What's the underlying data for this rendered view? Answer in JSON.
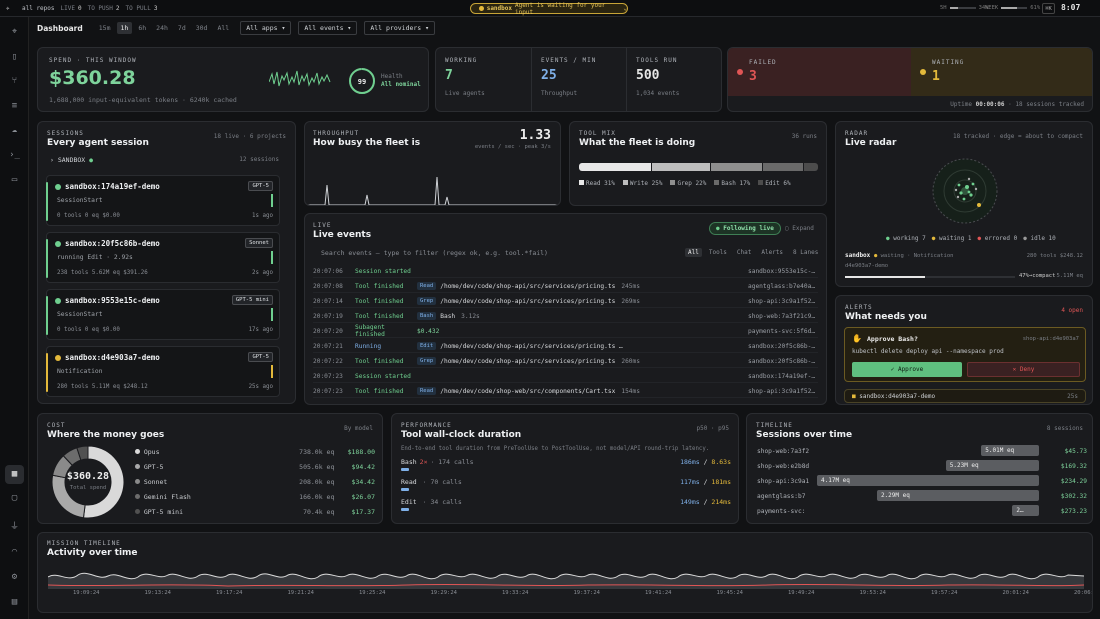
{
  "topbar": {
    "logo": "rocket-icon",
    "repos": "all repos",
    "live": "LIVE",
    "live_n": "0",
    "push": "TO PUSH",
    "push_n": "2",
    "pull": "TO PULL",
    "pull_n": "3",
    "waiting_tag": "sandbox",
    "waiting_text": "Agent is waiting for your input",
    "m1_label": "5H",
    "m1_val": "34%",
    "m1_fill": 0.34,
    "m2_label": "WEEK",
    "m2_val": "61%",
    "m2_fill": 0.61,
    "kbd": "⌘K",
    "clock": "8:07"
  },
  "filters": {
    "title": "Dashboard",
    "ranges": [
      "15m",
      "1h",
      "6h",
      "24h",
      "7d",
      "30d",
      "All"
    ],
    "active": "1h",
    "apps": "All apps",
    "events": "All events",
    "providers": "All providers"
  },
  "spend": {
    "label": "SPEND · THIS WINDOW",
    "value": "$360.28",
    "sub": "1,688,000 input-equivalent tokens · 6240k cached",
    "health_n": "99",
    "health_label": "Health",
    "health_status": "All nominal",
    "health_frac": 0.99
  },
  "kpis": [
    {
      "label": "WORKING",
      "value": "7",
      "sub": "Live agents",
      "color": "#7ed39b"
    },
    {
      "label": "EVENTS / MIN",
      "value": "25",
      "sub": "Throughput",
      "color": "#7fb0e8"
    },
    {
      "label": "TOOLS RUN",
      "value": "500",
      "sub": "1,034 events",
      "color": "#e6e6e6"
    }
  ],
  "failed": {
    "label": "FAILED",
    "value": "3"
  },
  "waiting": {
    "label": "WAITING",
    "value": "1"
  },
  "uptime": {
    "label": "Uptime",
    "value": "00:00:06",
    "tracked": "18 sessions tracked"
  },
  "sessions": {
    "label": "SESSIONS",
    "title": "Every agent session",
    "meta": "18 live · 6 projects",
    "group": "SANDBOX",
    "group_count": "12 sessions",
    "items": [
      {
        "name": "sandbox:174a19ef-demo",
        "model": "GPT-5",
        "status": "SessionStart",
        "stats": "0 tools  0 eq  $0.00",
        "age": "1s ago",
        "color": "#6fcf8f"
      },
      {
        "name": "sandbox:20f5c86b-demo",
        "model": "Sonnet",
        "status": "running Edit · 2.92s",
        "stats": "238 tools  5.62M eq  $391.26",
        "age": "2s ago",
        "color": "#6fcf8f"
      },
      {
        "name": "sandbox:9553e15c-demo",
        "model": "GPT-5 mini",
        "status": "SessionStart",
        "stats": "0 tools  0 eq  $0.00",
        "age": "17s ago",
        "color": "#6fcf8f"
      },
      {
        "name": "sandbox:d4e903a7-demo",
        "model": "GPT-5",
        "status": "Notification",
        "stats": "280 tools  5.11M eq  $248.12",
        "age": "25s ago",
        "color": "#e3b93b"
      }
    ]
  },
  "throughput": {
    "label": "THROUGHPUT",
    "title": "How busy the fleet is",
    "value": "1.33",
    "unit": "events / sec · peak 3/s"
  },
  "toolmix": {
    "label": "TOOL MIX",
    "title": "What the fleet is doing",
    "runs": "36 runs",
    "items": [
      {
        "name": "Read",
        "pct": "31%",
        "frac": 0.31,
        "color": "#e8e8e8"
      },
      {
        "name": "Write",
        "pct": "25%",
        "frac": 0.25,
        "color": "#bdbdbd"
      },
      {
        "name": "Grep",
        "pct": "22%",
        "frac": 0.22,
        "color": "#8f8f8f"
      },
      {
        "name": "Bash",
        "pct": "17%",
        "frac": 0.17,
        "color": "#6a6a6a"
      },
      {
        "name": "Edit",
        "pct": "6%",
        "frac": 0.06,
        "color": "#4c4c4c"
      }
    ]
  },
  "radar": {
    "label": "RADAR",
    "title": "Live radar",
    "meta": "18 tracked · edge = about to compact",
    "legend": [
      {
        "t": "working 7",
        "c": "#6fcf8f"
      },
      {
        "t": "waiting 1",
        "c": "#e3b93b"
      },
      {
        "t": "errored 0",
        "c": "#e05555"
      },
      {
        "t": "idle 10",
        "c": "#999"
      }
    ],
    "session": "sandbox",
    "state": "waiting · Notification",
    "id": "d4e903a7-demo",
    "stats": "280 tools  $248.12",
    "compact": "47%→compact",
    "eq": "5.11M eq",
    "compact_frac": 0.47
  },
  "live": {
    "label": "LIVE",
    "title": "Live events",
    "following": "Following live",
    "expand": "Expand",
    "filter_ph": "Search events — type to filter (regex ok, e.g. tool.*fail)",
    "tabs": [
      "All",
      "Tools",
      "Chat",
      "Alerts",
      "8 Lanes"
    ],
    "events": [
      {
        "t": "20:07:06",
        "k": "Session started",
        "tool": "",
        "d": "",
        "ms": "",
        "s": "sandbox:9553e15c-…",
        "c": "#6fcf8f"
      },
      {
        "t": "20:07:08",
        "k": "Tool finished",
        "tool": "Read",
        "d": "/home/dev/code/shop-api/src/services/pricing.ts",
        "ms": "245ms",
        "s": "agentglass:b7e40a…",
        "c": "#6fcf8f"
      },
      {
        "t": "20:07:14",
        "k": "Tool finished",
        "tool": "Grep",
        "d": "/home/dev/code/shop-api/src/services/pricing.ts",
        "ms": "269ms",
        "s": "shop-api:3c9a1f52…",
        "c": "#6fcf8f"
      },
      {
        "t": "20:07:19",
        "k": "Tool finished",
        "tool": "Bash",
        "d": "Bash",
        "ms": "3.12s",
        "s": "shop-web:7a3f21c9…",
        "c": "#6fcf8f"
      },
      {
        "t": "20:07:20",
        "k": "Subagent finished",
        "tool": "",
        "d": "$0.432",
        "ms": "",
        "s": "payments-svc:5f6d…",
        "c": "#6fcf8f"
      },
      {
        "t": "20:07:21",
        "k": "Running",
        "tool": "Edit",
        "d": "/home/dev/code/shop-api/src/services/pricing.ts …",
        "ms": "",
        "s": "sandbox:20f5c86b-…",
        "c": "#7fb0e8"
      },
      {
        "t": "20:07:22",
        "k": "Tool finished",
        "tool": "Grep",
        "d": "/home/dev/code/shop-api/src/services/pricing.ts",
        "ms": "260ms",
        "s": "sandbox:20f5c86b-…",
        "c": "#6fcf8f"
      },
      {
        "t": "20:07:23",
        "k": "Session started",
        "tool": "",
        "d": "",
        "ms": "",
        "s": "sandbox:174a19ef-…",
        "c": "#6fcf8f"
      },
      {
        "t": "20:07:23",
        "k": "Tool finished",
        "tool": "Read",
        "d": "/home/dev/code/shop-web/src/components/Cart.tsx",
        "ms": "154ms",
        "s": "shop-api:3c9a1f52…",
        "c": "#6fcf8f"
      }
    ]
  },
  "alerts": {
    "label": "ALERTS",
    "title": "What needs you",
    "count": "4 open",
    "approve_title": "Approve Bash?",
    "approve_src": "shop-api:d4e903a7",
    "cmd": "kubectl delete deploy api --namespace prod",
    "approve": "✓ Approve",
    "deny": "✕ Deny",
    "next": "sandbox:d4e903a7-demo",
    "next_age": "25s"
  },
  "cost": {
    "label": "COST",
    "title": "Where the money goes",
    "by": "By model",
    "total": "$360.28",
    "total_label": "Total spend",
    "rows": [
      {
        "n": "Opus",
        "eq": "738.0k eq",
        "v": "$188.00",
        "c": "#d9d9d9",
        "f": 0.52
      },
      {
        "n": "GPT-5",
        "eq": "505.6k eq",
        "v": "$94.42",
        "c": "#a9a9a9",
        "f": 0.26
      },
      {
        "n": "Sonnet",
        "eq": "208.0k eq",
        "v": "$34.42",
        "c": "#8a8a8a",
        "f": 0.1
      },
      {
        "n": "Gemini Flash",
        "eq": "166.0k eq",
        "v": "$26.07",
        "c": "#6c6c6c",
        "f": 0.07
      },
      {
        "n": "GPT-5 mini",
        "eq": "70.4k eq",
        "v": "$17.37",
        "c": "#515151",
        "f": 0.05
      }
    ]
  },
  "perf": {
    "label": "PERFORMANCE",
    "title": "Tool wall-clock duration",
    "p": "p50 · p95",
    "desc": "End-to-end tool duration from PreToolUse to PostToolUse, not model/API round-trip latency.",
    "rows": [
      {
        "n": "Bash",
        "x": "2×",
        "calls": "· 174 calls",
        "p50": "186ms",
        "p95": "8.63s"
      },
      {
        "n": "Read",
        "x": "",
        "calls": "· 70 calls",
        "p50": "117ms",
        "p95": "181ms"
      },
      {
        "n": "Edit",
        "x": "",
        "calls": "· 34 calls",
        "p50": "149ms",
        "p95": "214ms"
      }
    ]
  },
  "timeline": {
    "label": "TIMELINE",
    "title": "Sessions over time",
    "count": "8 sessions",
    "rows": [
      {
        "n": "shop-web:7a3f2",
        "eq": "5.01M eq",
        "v": "$45.73",
        "s": 0.74,
        "w": 0.26
      },
      {
        "n": "shop-web:e2b8d",
        "eq": "5.23M eq",
        "v": "$169.32",
        "s": 0.58,
        "w": 0.42
      },
      {
        "n": "shop-api:3c9a1",
        "eq": "4.17M eq",
        "v": "$234.29",
        "s": 0.0,
        "w": 1.0
      },
      {
        "n": "agentglass:b7",
        "eq": "2.29M eq",
        "v": "$302.32",
        "s": 0.27,
        "w": 0.73
      },
      {
        "n": "payments-svc:",
        "eq": "2…",
        "v": "$273.23",
        "s": 0.88,
        "w": 0.12
      }
    ]
  },
  "mission": {
    "label": "MISSION TIMELINE",
    "title": "Activity over time",
    "ticks": [
      "19:09:24",
      "19:13:24",
      "19:17:24",
      "19:21:24",
      "19:25:24",
      "19:29:24",
      "19:33:24",
      "19:37:24",
      "19:41:24",
      "19:45:24",
      "19:49:24",
      "19:53:24",
      "19:57:24",
      "20:01:24",
      "20:06:24"
    ]
  }
}
